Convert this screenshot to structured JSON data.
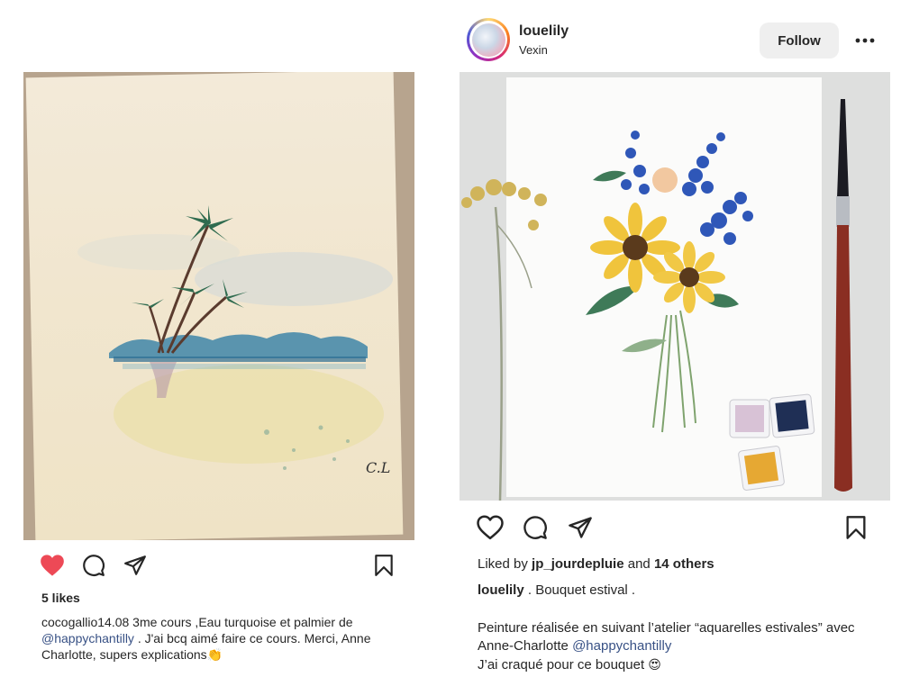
{
  "left_post": {
    "likes": "5 likes",
    "caption": {
      "user": "cocogallio14.08",
      "text1": " 3me cours ,Eau turquoise et palmier de ",
      "mention": "@happychantilly",
      "text2": " . J'ai bcq aimé faire ce cours.  Merci, Anne Charlotte,  supers explications",
      "emoji": "👏"
    },
    "signature": "C.L",
    "liked": true,
    "colors": {
      "heart": "#ed4956",
      "mention": "#385185"
    }
  },
  "right_post": {
    "header": {
      "username": "louelily",
      "location": "Vexin",
      "follow_label": "Follow"
    },
    "liked_by": {
      "prefix": "Liked by ",
      "user": "jp_jourdepluie",
      "middle": " and ",
      "others": "14 others"
    },
    "caption": {
      "user": "louelily",
      "line1": " . Bouquet estival .",
      "line2a": "Peinture réalisée en suivant l’atelier “aquarelles estivales” avec Anne-Charlotte ",
      "mention": "@happychantilly",
      "line3": "J’ai craqué pour ce bouquet ",
      "emoji": "😍"
    }
  },
  "icons": [
    "heart-icon",
    "comment-icon",
    "share-icon",
    "bookmark-icon",
    "more-icon"
  ]
}
